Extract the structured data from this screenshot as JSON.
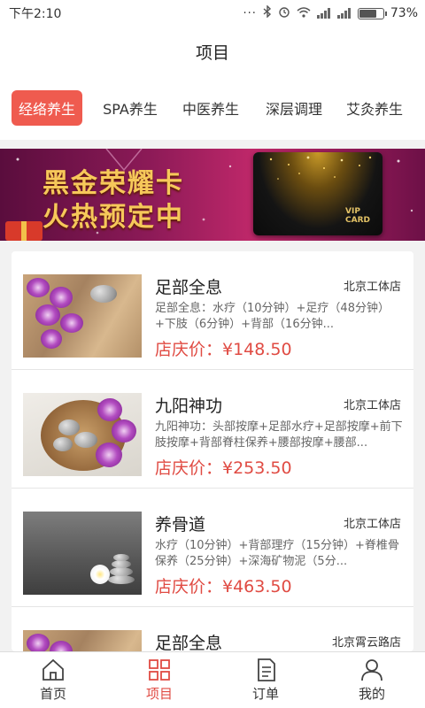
{
  "status_bar": {
    "time": "下午2:10",
    "battery": "73%",
    "battery_level": 0.73
  },
  "header": {
    "title": "项目"
  },
  "tabs": [
    {
      "label": "经络养生",
      "active": true
    },
    {
      "label": "SPA养生",
      "active": false
    },
    {
      "label": "中医养生",
      "active": false
    },
    {
      "label": "深层调理",
      "active": false
    },
    {
      "label": "艾灸养生",
      "active": false
    }
  ],
  "banner": {
    "line1": "黑金荣耀卡",
    "line2": "火热预定中",
    "card_label": "VIP CARD"
  },
  "items": [
    {
      "name": "足部全息",
      "store": "北京工体店",
      "desc": "足部全息：水疗（10分钟）+足疗（48分钟）+下肢（6分钟）+背部（16分钟...",
      "price": "店庆价：¥148.50"
    },
    {
      "name": "九阳神功",
      "store": "北京工体店",
      "desc": "九阳神功：头部按摩+足部水疗+足部按摩+前下肢按摩+背部脊柱保养+腰部按摩+腰部...",
      "price": "店庆价：¥253.50"
    },
    {
      "name": "养骨道",
      "store": "北京工体店",
      "desc": "水疗（10分钟）+背部理疗（15分钟）+脊椎骨保养（25分钟）+深海矿物泥（5分...",
      "price": "店庆价：¥463.50"
    },
    {
      "name": "足部全息",
      "store": "北京霄云路店",
      "desc": "",
      "price": ""
    }
  ],
  "nav": [
    {
      "label": "首页",
      "icon": "home-icon",
      "active": false
    },
    {
      "label": "项目",
      "icon": "grid-icon",
      "active": true
    },
    {
      "label": "订单",
      "icon": "order-icon",
      "active": false
    },
    {
      "label": "我的",
      "icon": "user-icon",
      "active": false
    }
  ],
  "colors": {
    "accent": "#ef5b4f",
    "price": "#e04b43",
    "banner_gold": "#f6c85a"
  }
}
